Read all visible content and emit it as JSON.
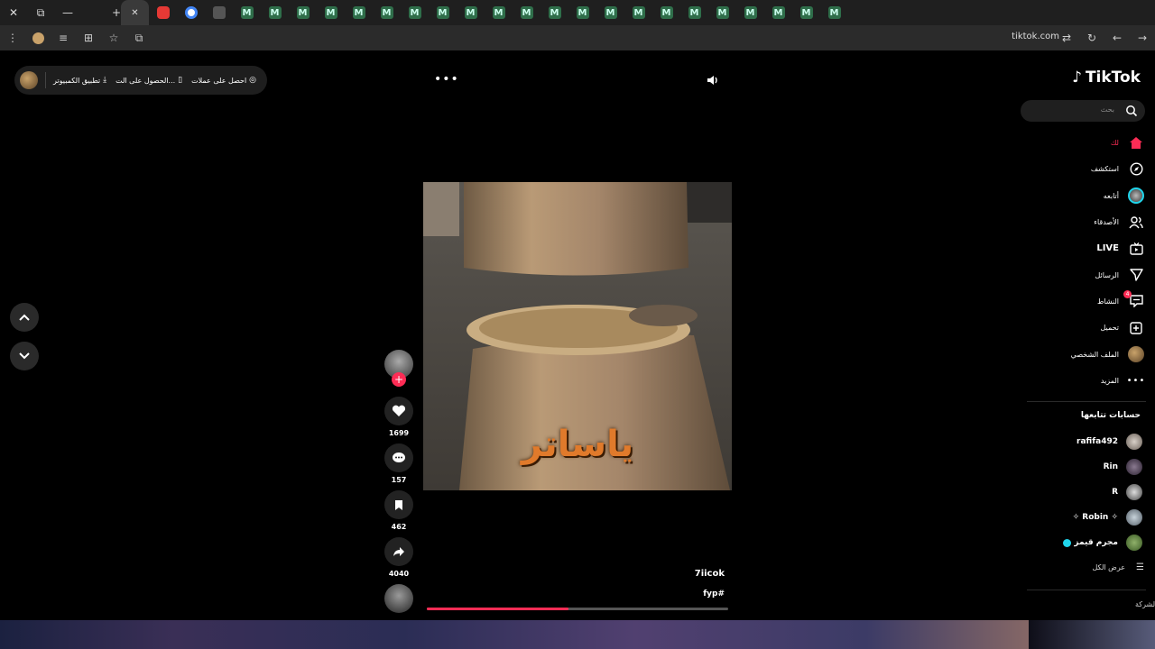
{
  "browser": {
    "url": "tiktok.com",
    "tabs": [
      "ext",
      "google",
      "tiktok",
      "m",
      "m",
      "m",
      "m",
      "m",
      "m",
      "m",
      "m",
      "m",
      "m",
      "m",
      "m",
      "m",
      "m",
      "m",
      "m",
      "m",
      "m",
      "m",
      "m",
      "m",
      "m"
    ],
    "m_label": "M"
  },
  "topbar": {
    "coins_label": "احصل على عملات",
    "get_app_label": "الحصول على الت...",
    "desktop_app_label": "تطبيق الكمبيوتر"
  },
  "sidebar": {
    "logo_text": "TikTok",
    "search_placeholder": "بحث",
    "items": [
      {
        "label": "لك",
        "icon": "home-icon"
      },
      {
        "label": "استكشف",
        "icon": "compass-icon"
      },
      {
        "label": "أتابعه",
        "icon": "following-avatar-icon"
      },
      {
        "label": "الأصدقاء",
        "icon": "friends-icon"
      },
      {
        "label": "LIVE",
        "icon": "live-icon"
      },
      {
        "label": "الرسائل",
        "icon": "send-icon"
      },
      {
        "label": "النشاط",
        "icon": "activity-icon",
        "badge": "4"
      },
      {
        "label": "تحميل",
        "icon": "upload-icon"
      },
      {
        "label": "الملف الشخصي",
        "icon": "profile-avatar-icon"
      },
      {
        "label": "المزيد",
        "icon": "more-icon"
      }
    ],
    "following_title": "حسابات تتابعها",
    "following": [
      {
        "name": "rafifa492"
      },
      {
        "name": "Rin"
      },
      {
        "name": "R"
      },
      {
        "name": "✧ Robin ✧"
      },
      {
        "name": "مجرم قيمز"
      }
    ],
    "see_all": "عرض الكل",
    "company": "الشركة"
  },
  "video": {
    "caption": "ياساتر",
    "author": "7iicok",
    "tags": "fyp#",
    "progress": 0.47
  },
  "actions": {
    "likes": "1699",
    "comments": "157",
    "bookmarks": "462",
    "shares": "4040"
  },
  "colors": {
    "accent": "#fe2c55",
    "background": "#000000"
  }
}
